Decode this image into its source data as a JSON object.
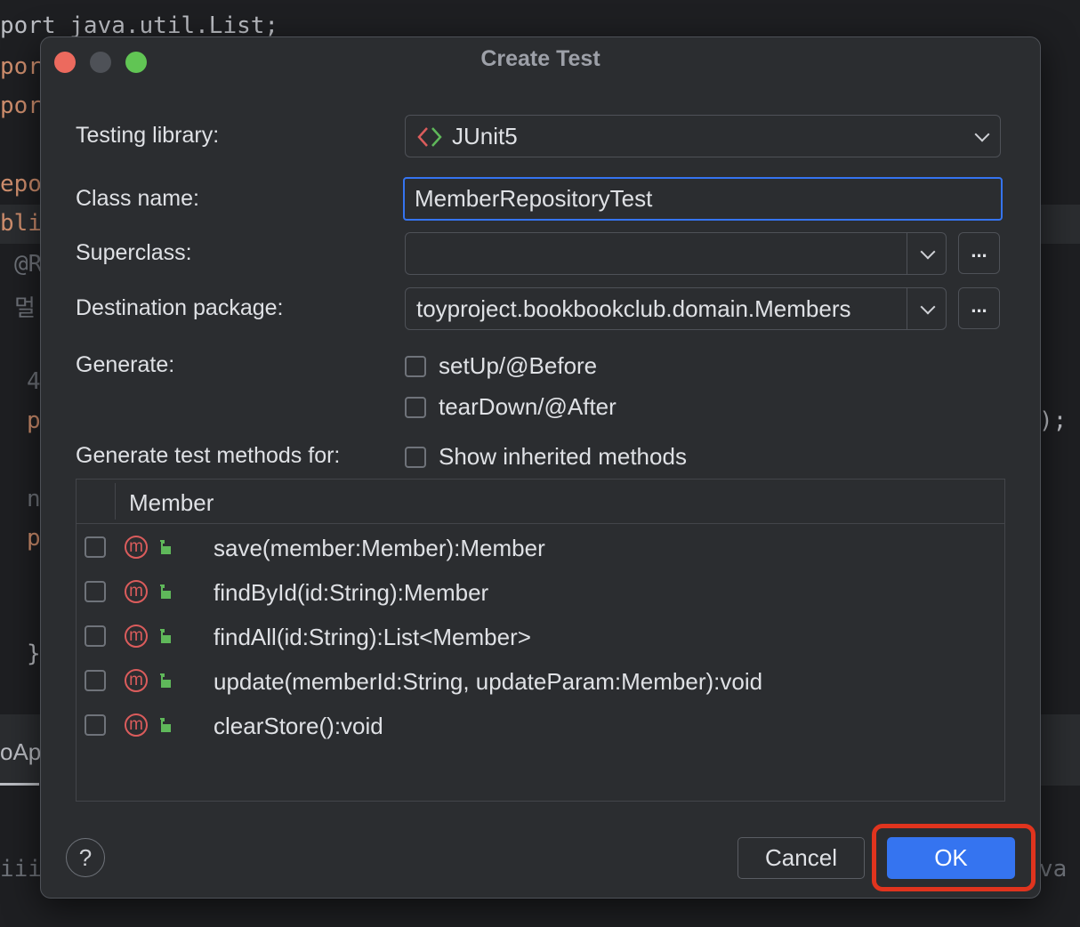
{
  "background_code": {
    "line1": "port java.util.List;",
    "line2": "por",
    "line3": "por",
    "line4": "epo",
    "line5": "bli",
    "line6": "@R",
    "line7": "멀",
    "line8": "4",
    "line9": "p",
    "line10": "n",
    "line11": "p",
    "line12": "}",
    "line13": ");",
    "line14": "oApp",
    "line15": "iiii",
    "line16": "va"
  },
  "dialog": {
    "title": "Create Test",
    "testing_library": {
      "label": "Testing library:",
      "value": "JUnit5"
    },
    "class_name": {
      "label": "Class name:",
      "value": "MemberRepositoryTest"
    },
    "superclass": {
      "label": "Superclass:",
      "value": "",
      "browse": "..."
    },
    "destination_package": {
      "label": "Destination package:",
      "value": "toyproject.bookbookclub.domain.Members",
      "browse": "..."
    },
    "generate": {
      "label": "Generate:",
      "options": [
        {
          "label": "setUp/@Before",
          "checked": false
        },
        {
          "label": "tearDown/@After",
          "checked": false
        }
      ]
    },
    "generate_methods": {
      "label": "Generate test methods for:",
      "show_inherited": {
        "label": "Show inherited methods",
        "checked": false
      }
    },
    "members_table": {
      "header": "Member",
      "rows": [
        {
          "icon": "m",
          "signature": "save(member:Member):Member",
          "checked": false
        },
        {
          "icon": "m",
          "signature": "findById(id:String):Member",
          "checked": false
        },
        {
          "icon": "m",
          "signature": "findAll(id:String):List<Member>",
          "checked": false
        },
        {
          "icon": "m",
          "signature": "update(memberId:String, updateParam:Member):void",
          "checked": false
        },
        {
          "icon": "m",
          "signature": "clearStore():void",
          "checked": false
        }
      ]
    },
    "help": "?",
    "cancel": "Cancel",
    "ok": "OK"
  },
  "colors": {
    "accent": "#3574f0",
    "highlight": "#e0341e",
    "method_icon": "#db5c5c",
    "lock_icon": "#5fb85a"
  },
  "icons": [
    "junit-icon",
    "chevron-down-icon",
    "method-icon",
    "unlock-icon",
    "help-icon"
  ]
}
